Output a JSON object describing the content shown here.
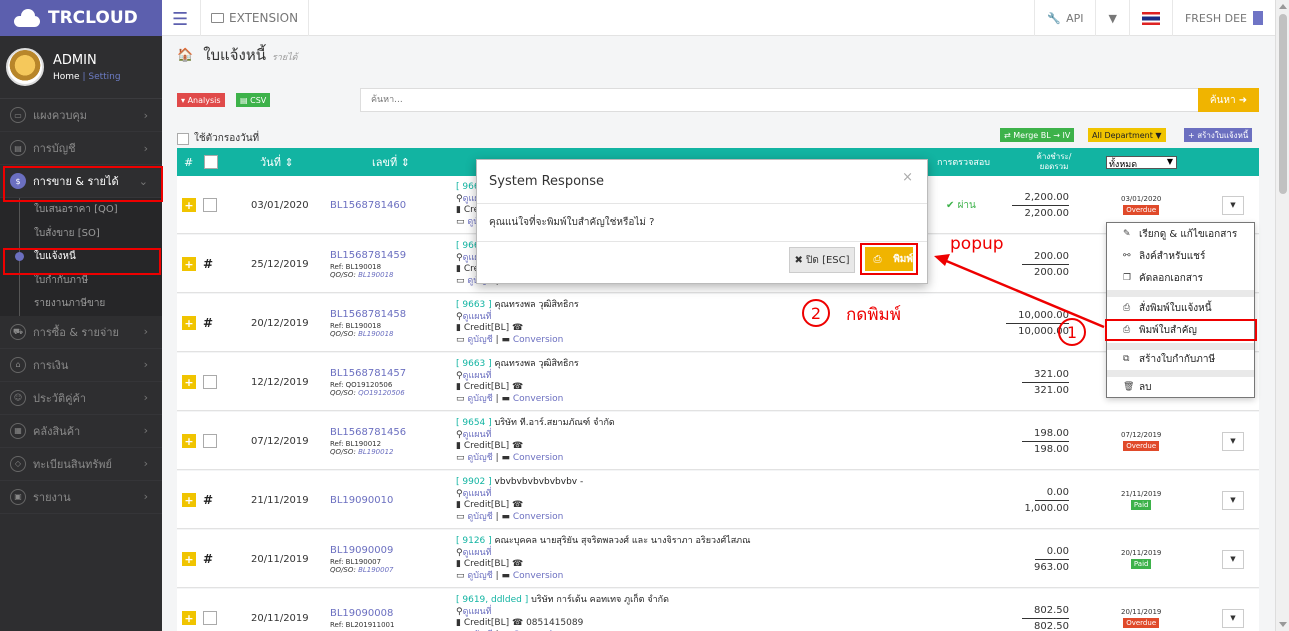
{
  "app": {
    "logo": "TRCLOUD",
    "menu_label": "EXTENSION",
    "api_label": "API",
    "company": "FRESH DEE"
  },
  "profile": {
    "name": "ADMIN",
    "home": "Home",
    "setting": "Setting"
  },
  "sidebar": {
    "items": [
      {
        "label": "แผงควบคุม"
      },
      {
        "label": "การบัญชี"
      },
      {
        "label": "การขาย & รายได้",
        "active": true
      }
    ],
    "sub_items": [
      {
        "label": "ใบเสนอราคา [QO]"
      },
      {
        "label": "ใบสั่งขาย [SO]"
      },
      {
        "label": "ใบแจ้งหนี้",
        "current": true
      },
      {
        "label": "ใบกำกับภาษี"
      },
      {
        "label": "รายงานภาษีขาย"
      }
    ],
    "more_items": [
      {
        "label": "การซื้อ & รายจ่าย"
      },
      {
        "label": "การเงิน"
      },
      {
        "label": "ประวัติคู่ค้า"
      },
      {
        "label": "คลังสินค้า"
      },
      {
        "label": "ทะเบียนสินทรัพย์"
      },
      {
        "label": "รายงาน"
      }
    ]
  },
  "page": {
    "title": "ใบแจ้งหนี้",
    "subtitle": "รายได้"
  },
  "toolbar": {
    "analysis": "Analysis",
    "csv": "CSV",
    "search_placeholder": "ค้นหา...",
    "search_button": "ค้นหา",
    "date_filter": "ใช้ตัวกรองวันที่",
    "merge": "Merge BL → IV",
    "department": "All Department",
    "create": "สร้างใบแจ้งหนี้"
  },
  "table": {
    "headers": {
      "num": "#",
      "date": "วันที่",
      "doc": "เลขที่",
      "check": "การตรวจสอบ",
      "balance_1": "ค้างชำระ/",
      "balance_2": "ยอดรวม",
      "filter": "ทั้งหมด"
    },
    "rows": [
      {
        "mark": "box",
        "date": "03/01/2020",
        "doc": "BL1568781460",
        "ref": "",
        "qo_label": "",
        "qo": "",
        "cust_code": "[ 9663 ]",
        "cust_name": "",
        "l2": "ดูแผนที่",
        "l3": "Credit[BL]",
        "l4": "ดูบัญชี",
        "conv": "Conversion",
        "phone": "",
        "check": "ผ่าน",
        "due": "2,200.00",
        "total": "2,200.00",
        "status_date": "03/01/2020",
        "status": "Overdue",
        "status_kind": "overdue",
        "has_dd": true
      },
      {
        "mark": "hash",
        "date": "25/12/2019",
        "doc": "BL1568781459",
        "ref": "Ref: BL190018",
        "qo_label": "QO/SO:",
        "qo": "BL190018",
        "cust_code": "[ 9663 ]",
        "cust_name": "",
        "l2": "ดูแผนที่",
        "l3": "Credit[BL]",
        "l4": "ดูบัญชี",
        "conv": "Conversion",
        "phone": "",
        "check": "",
        "due": "200.00",
        "total": "200.00",
        "status_date": "",
        "status": "",
        "status_kind": "",
        "has_dd": false
      },
      {
        "mark": "hash",
        "date": "20/12/2019",
        "doc": "BL1568781458",
        "ref": "Ref: BL190018",
        "qo_label": "QO/SO:",
        "qo": "BL190018",
        "cust_code": "[ 9663 ]",
        "cust_name": "คุณทรงพล วุฒิสิทธิกร",
        "l2": "ดูแผนที่",
        "l3": "Credit[BL]",
        "l4": "ดูบัญชี",
        "conv": "Conversion",
        "phone": "",
        "check": "",
        "due": "10,000.00",
        "total": "10,000.00",
        "status_date": "",
        "status": "",
        "status_kind": "",
        "has_dd": false
      },
      {
        "mark": "box",
        "date": "12/12/2019",
        "doc": "BL1568781457",
        "ref": "Ref: QO19120506",
        "qo_label": "QO/SO:",
        "qo": "QO19120506",
        "cust_code": "[ 9663 ]",
        "cust_name": "คุณทรงพล วุฒิสิทธิกร",
        "l2": "ดูแผนที่",
        "l3": "Credit[BL]",
        "l4": "ดูบัญชี",
        "conv": "Conversion",
        "phone": "",
        "check": "",
        "due": "321.00",
        "total": "321.00",
        "status_date": "",
        "status": "",
        "status_kind": "",
        "has_dd": false
      },
      {
        "mark": "box",
        "date": "07/12/2019",
        "doc": "BL1568781456",
        "ref": "Ref: BL190012",
        "qo_label": "QO/SO:",
        "qo": "BL190012",
        "cust_code": "[ 9654 ]",
        "cust_name": "บริษัท ที.อาร์.สยามภัณฑ์ จำกัด",
        "l2": "ดูแผนที่",
        "l3": "Credit[BL]",
        "l4": "ดูบัญชี",
        "conv": "Conversion",
        "phone": "",
        "check": "",
        "due": "198.00",
        "total": "198.00",
        "status_date": "07/12/2019",
        "status": "Overdue",
        "status_kind": "overdue",
        "has_dd": true
      },
      {
        "mark": "hash",
        "date": "21/11/2019",
        "doc": "BL19090010",
        "ref": "",
        "qo_label": "",
        "qo": "",
        "cust_code": "[ 9902 ]",
        "cust_name": "vbvbvbvbvbvbvbv -",
        "l2": "ดูแผนที่",
        "l3": "Credit[BL]",
        "l4": "ดูบัญชี",
        "conv": "Conversion",
        "phone": "",
        "check": "",
        "due": "0.00",
        "total": "1,000.00",
        "status_date": "21/11/2019",
        "status": "Paid",
        "status_kind": "paid",
        "has_dd": true
      },
      {
        "mark": "hash",
        "date": "20/11/2019",
        "doc": "BL19090009",
        "ref": "Ref: BL190007",
        "qo_label": "QO/SO:",
        "qo": "BL190007",
        "cust_code": "[ 9126 ]",
        "cust_name": "คณะบุคคล นายสุริยัน สุจริตพลวงศ์ และ นางจิราภา อริยวงศ์ไสภณ",
        "l2": "ดูแผนที่",
        "l3": "Credit[BL]",
        "l4": "ดูบัญชี",
        "conv": "Conversion",
        "phone": "",
        "check": "",
        "due": "0.00",
        "total": "963.00",
        "status_date": "20/11/2019",
        "status": "Paid",
        "status_kind": "paid",
        "has_dd": true
      },
      {
        "mark": "box",
        "date": "20/11/2019",
        "doc": "BL19090008",
        "ref": "Ref: BL201911001",
        "qo_label": "",
        "qo": "",
        "cust_code": "[ 9619, ddlded ]",
        "cust_name": "บริษัท การ์เด้น คอทเทจ ภูเก็ต จำกัด",
        "l2": "ดูแผนที่",
        "l3": "Credit[BL]",
        "l4": "ดูบัญชี",
        "conv": "Conversion",
        "phone": "0851415089",
        "check": "",
        "due": "802.50",
        "total": "802.50",
        "status_date": "20/11/2019",
        "status": "Overdue",
        "status_kind": "overdue",
        "has_dd": true
      }
    ]
  },
  "modal": {
    "title": "System Response",
    "message": "คุณแน่ใจที่จะพิมพ์ใบสำคัญใช่หรือไม่ ?",
    "close_button": "ปิด [ESC]",
    "print_button": "พิมพ์"
  },
  "context_menu": {
    "items": [
      {
        "label": "เรียกดู & แก้ไขเอกสาร",
        "icon": "edit-icon"
      },
      {
        "label": "ลิงค์สำหรับแชร์",
        "icon": "link-icon"
      },
      {
        "label": "คัดลอกเอกสาร",
        "icon": "copy-icon"
      },
      {
        "label": "สั่งพิมพ์ใบแจ้งหนี้",
        "icon": "print-icon"
      },
      {
        "label": "พิมพ์ใบสำคัญ",
        "icon": "print-icon"
      },
      {
        "label": "สร้างใบกำกับภาษี",
        "icon": "clone-icon"
      },
      {
        "label": "ลบ",
        "icon": "trash-icon"
      }
    ]
  },
  "annotations": {
    "popup": "popup",
    "step1": "1",
    "step2": "2",
    "step2_text": "กดพิมพ์"
  },
  "colors": {
    "brand": "#5c5fae",
    "table_header": "#12b4a2",
    "highlight": "#e00000",
    "button_yellow": "#f0b400"
  }
}
